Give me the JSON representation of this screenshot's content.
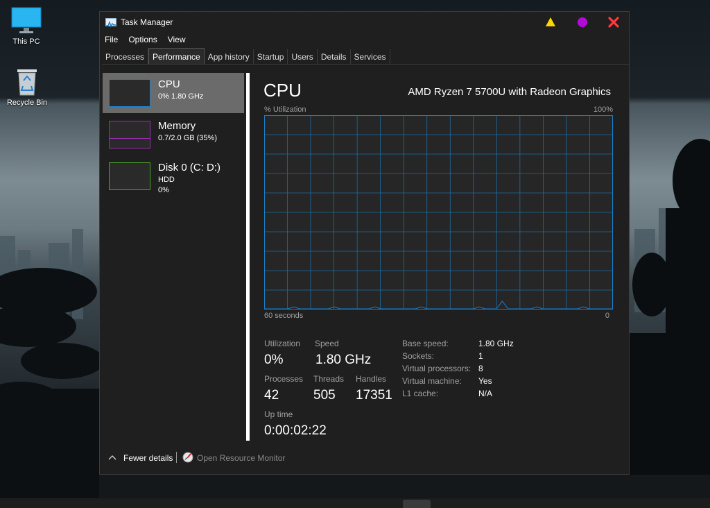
{
  "desktop": {
    "icons": [
      {
        "label": "This PC"
      },
      {
        "label": "Recycle Bin"
      }
    ]
  },
  "window": {
    "title": "Task Manager",
    "controls": {
      "minimize_color": "#ffd700",
      "maximize_color": "#b40ad9",
      "close_color": "#ff3b3b"
    }
  },
  "menu": [
    "File",
    "Options",
    "View"
  ],
  "tabs": [
    {
      "label": "Processes",
      "active": false
    },
    {
      "label": "Performance",
      "active": true
    },
    {
      "label": "App history",
      "active": false
    },
    {
      "label": "Startup",
      "active": false
    },
    {
      "label": "Users",
      "active": false
    },
    {
      "label": "Details",
      "active": false
    },
    {
      "label": "Services",
      "active": false
    }
  ],
  "sidebar": {
    "items": [
      {
        "name": "CPU",
        "sub1": "0%  1.80 GHz",
        "sub2": "",
        "border_color": "#1a7fc8",
        "selected": true
      },
      {
        "name": "Memory",
        "sub1": "0.7/2.0 GB (35%)",
        "sub2": "",
        "border_color": "#9b2fb0",
        "selected": false
      },
      {
        "name": "Disk 0 (C: D:)",
        "sub1": "HDD",
        "sub2": "0%",
        "border_color": "#4caa2a",
        "selected": false
      }
    ]
  },
  "cpu": {
    "heading": "CPU",
    "model": "AMD Ryzen 7 5700U with Radeon Graphics",
    "graph": {
      "y_label": "% Utilization",
      "y_max_label": "100%",
      "x_left_label": "60 seconds",
      "x_right_label": "0",
      "line_color": "#1a7fc8",
      "grid_color": "#1d6ea3",
      "utilization_history": [
        0,
        0,
        0,
        0,
        0,
        1,
        0,
        0,
        0,
        0,
        0,
        0,
        1,
        0,
        0,
        0,
        0,
        0,
        0,
        1,
        0,
        0,
        0,
        0,
        0,
        0,
        0,
        1,
        0,
        0,
        0,
        0,
        0,
        0,
        0,
        0,
        0,
        1,
        0,
        0,
        0,
        4,
        0,
        0,
        0,
        0,
        0,
        1,
        0,
        0,
        0,
        0,
        0,
        0,
        0,
        1,
        0,
        0,
        0,
        0,
        0
      ]
    },
    "stats": {
      "utilization_label": "Utilization",
      "utilization": "0%",
      "speed_label": "Speed",
      "speed": "1.80 GHz",
      "processes_label": "Processes",
      "processes": "42",
      "threads_label": "Threads",
      "threads": "505",
      "handles_label": "Handles",
      "handles": "17351",
      "uptime_label": "Up time",
      "uptime": "0:00:02:22"
    },
    "specs": [
      {
        "label": "Base speed:",
        "value": "1.80 GHz"
      },
      {
        "label": "Sockets:",
        "value": "1"
      },
      {
        "label": "Virtual processors:",
        "value": "8"
      },
      {
        "label": "Virtual machine:",
        "value": "Yes"
      },
      {
        "label": "L1 cache:",
        "value": "N/A"
      }
    ]
  },
  "footer": {
    "fewer_details": "Fewer details",
    "open_resource_monitor": "Open Resource Monitor"
  }
}
